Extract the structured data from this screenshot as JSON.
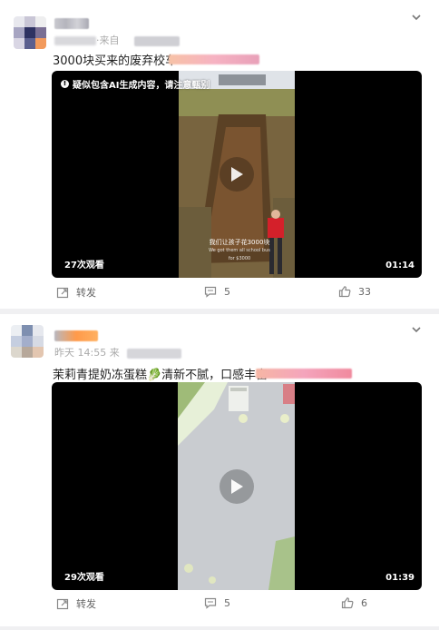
{
  "feed": {
    "posts": [
      {
        "meta_visible": "·来自",
        "text": "3000块买来的废弃校车",
        "video": {
          "ai_notice": "疑似包含AI生成内容，请注意甄别",
          "caption_cn": "我们让孩子花3000块",
          "caption_en": "We got them all school bus for $3000",
          "views": "27次观看",
          "duration": "01:14"
        },
        "actions": {
          "repost": "转发",
          "comments": "5",
          "likes": "33"
        }
      },
      {
        "meta_visible": "昨天 14:55 来",
        "text": "茉莉青提奶冻蛋糕🥬清新不腻，口感丰富～",
        "video": {
          "views": "29次观看",
          "duration": "01:39"
        },
        "actions": {
          "repost": "转发",
          "comments": "5",
          "likes": "6"
        }
      }
    ]
  },
  "icons": {
    "more": "chevron-down-icon",
    "repost": "repost-icon",
    "comment": "comment-icon",
    "like": "thumbs-up-icon",
    "play": "play-icon"
  },
  "colors": {
    "page_bg": "#f0f0f2",
    "card_bg": "#ffffff",
    "accent_blur": "#ff8a3d"
  }
}
